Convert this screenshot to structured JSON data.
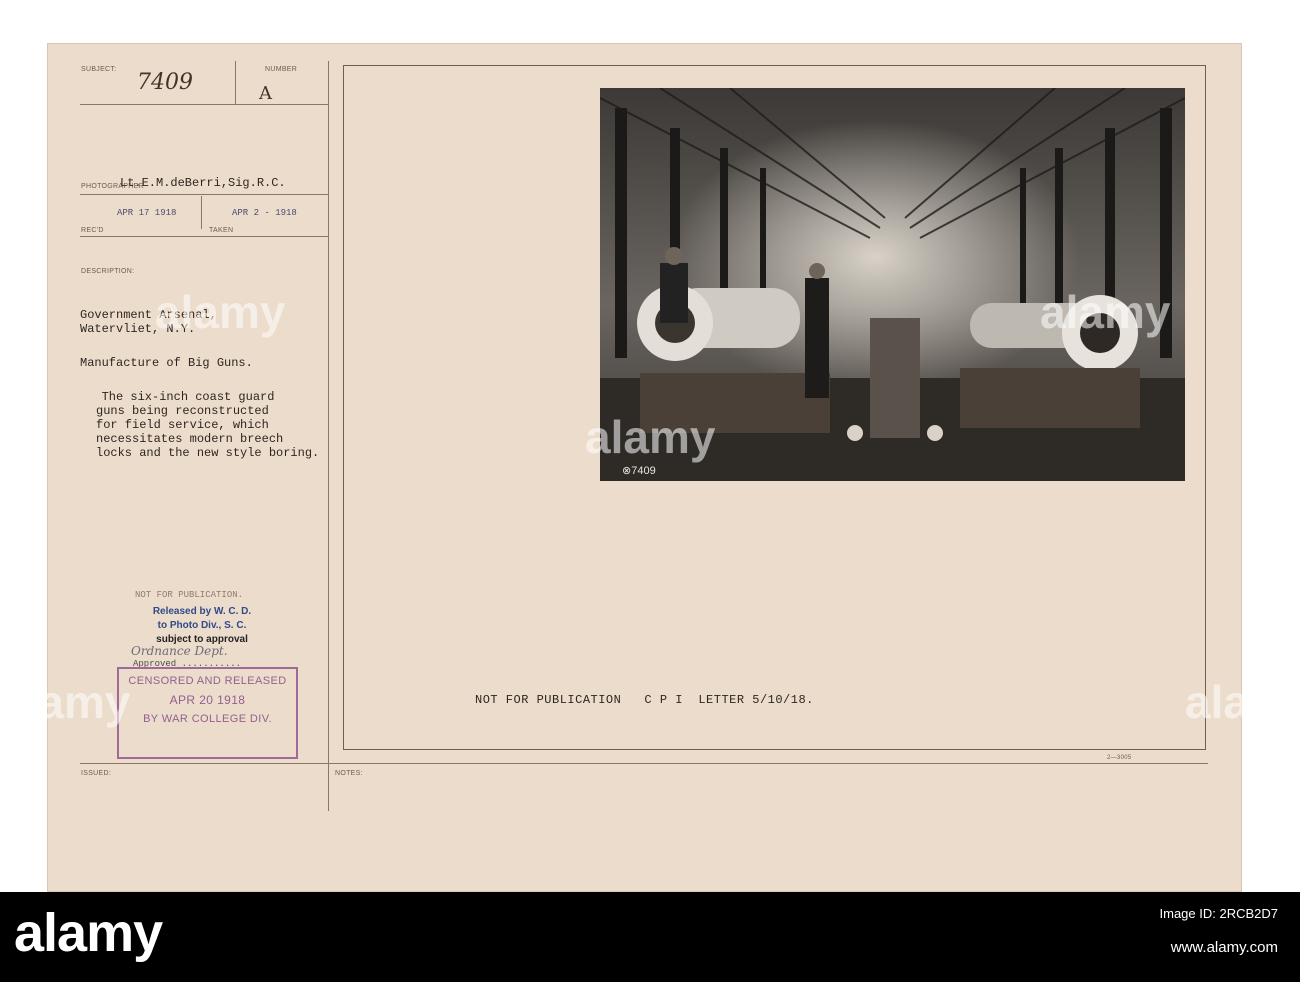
{
  "form": {
    "subject_label": "SUBJECT:",
    "subject_value": "7409",
    "number_label": "NUMBER",
    "number_value": "A",
    "photographer_label": "PHOTOGRAPHER",
    "photographer_value": "Lt.E.M.deBerri,Sig.R.C.",
    "recd_date": "APR 17 1918",
    "recd_label": "REC'D",
    "taken_date": "APR 2 - 1918",
    "taken_label": "TAKEN",
    "description_label": "DESCRIPTION:",
    "description_lines": [
      "Government Arsenal,",
      "Watervliet, N.Y.",
      "Manufacture of Big Guns.",
      "   The six-inch coast guard",
      "guns being reconstructed",
      "for field service, which",
      "necessitates modern breech",
      "locks and the new style boring."
    ],
    "issued_label": "ISSUED:",
    "notes_label": "NOTES:",
    "form_code": "2—3005"
  },
  "release": {
    "faint_line": "NOT FOR PUBLICATION.",
    "line1": "Released by W. C. D.",
    "line2": "to Photo Div., S. C.",
    "line3": "subject to approval",
    "handwritten": "Ordnance Dept.",
    "approved": "Approved ..........."
  },
  "censor_stamp": {
    "line1": "CENSORED AND RELEASED",
    "line2": "APR 20 1918",
    "line3": "BY WAR COLLEGE DIV."
  },
  "photo": {
    "negative_number": "⊗7409"
  },
  "footer_note": "NOT FOR PUBLICATION   C P I  LETTER 5/10/18.",
  "watermark": {
    "word": "alamy",
    "image_id": "2RCB2D7",
    "site": "www.alamy.com"
  }
}
